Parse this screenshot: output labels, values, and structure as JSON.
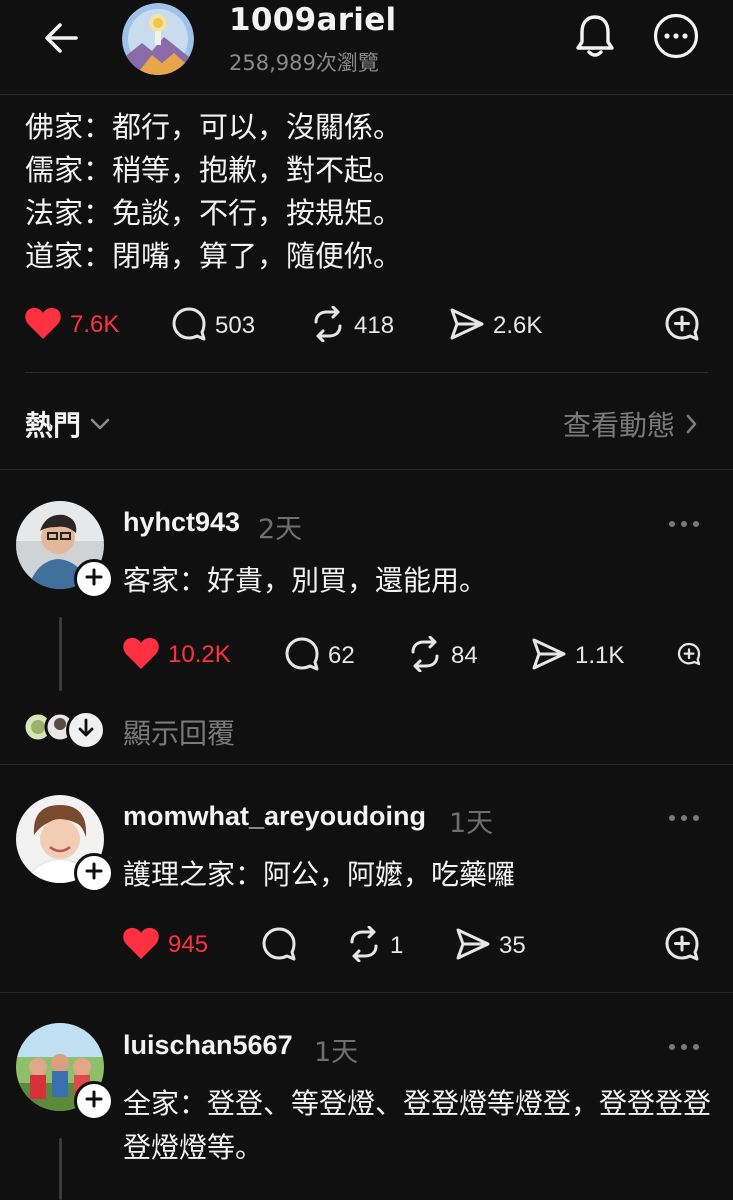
{
  "header": {
    "username": "1009ariel",
    "views": "258,989次瀏覽",
    "back_icon": "arrow-left-icon",
    "bell_icon": "bell-icon",
    "more_icon": "more-circle-icon"
  },
  "post": {
    "lines": [
      "佛家：都行，可以，沒關係。",
      "儒家：稍等，抱歉，對不起。",
      "法家：免談，不行，按規矩。",
      "道家：閉嘴，算了，隨便你。"
    ],
    "likes": "7.6K",
    "comments": "503",
    "reposts": "418",
    "shares": "2.6K"
  },
  "sort": {
    "label": "熱門",
    "activity": "查看動態"
  },
  "replies": [
    {
      "username": "hyhct943",
      "time": "2天",
      "text": "客家：好貴，別買，還能用。",
      "likes": "10.2K",
      "comments": "62",
      "reposts": "84",
      "shares": "1.1K",
      "show_replies": "顯示回覆"
    },
    {
      "username": "momwhat_areyoudoing",
      "time": "1天",
      "text": "護理之家：阿公，阿嬤，吃藥囉",
      "likes": "945",
      "comments": "",
      "reposts": "1",
      "shares": "35"
    },
    {
      "username": "luischan5667",
      "time": "1天",
      "text": "全家：登登、等登燈、登登燈等燈登，登登登登登燈燈等。"
    }
  ],
  "colors": {
    "background": "#101010",
    "like_red": "#ff3040",
    "muted": "#7a7a7a"
  }
}
